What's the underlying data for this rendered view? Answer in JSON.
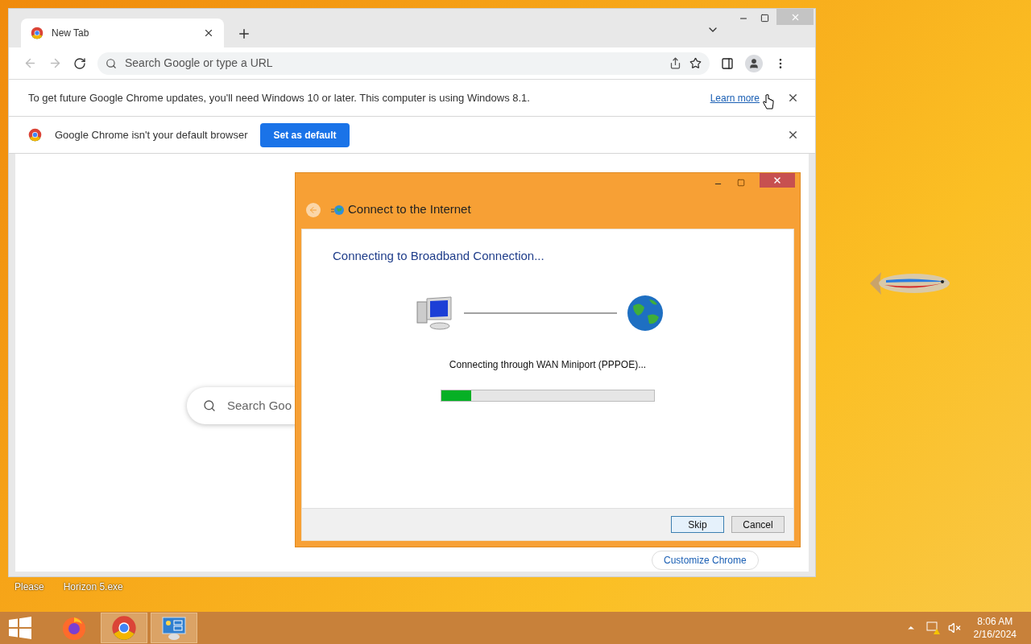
{
  "browser": {
    "tabs": [
      {
        "title": "New Tab",
        "selected": true
      }
    ],
    "address_bar": {
      "placeholder": "Search Google or type a URL"
    },
    "infobars": [
      {
        "kind": "notice",
        "text": "To get future Google Chrome updates, you'll need Windows 10 or later. This computer is using Windows 8.1.",
        "link": "Learn more"
      },
      {
        "kind": "default_browser",
        "text": "Google Chrome isn't your default browser",
        "button": "Set as default"
      }
    ],
    "page": {
      "search_placeholder": "Search Goo",
      "customize_button": "Customize Chrome"
    }
  },
  "dialog": {
    "title": "Connect to the Internet",
    "heading": "Connecting to Broadband Connection...",
    "status": "Connecting through WAN Miniport (PPPOE)...",
    "progress": {
      "level": 0.14
    },
    "buttons": [
      {
        "label": "Skip",
        "selected": true
      },
      {
        "label": "Cancel",
        "selected": false
      }
    ]
  },
  "desktop_icons": [
    {
      "label": "Please"
    },
    {
      "label": "Horizon 5.exe"
    }
  ],
  "taskbar": {
    "apps": [
      {
        "kind": "firefox",
        "active": false
      },
      {
        "kind": "chrome",
        "active": true
      },
      {
        "kind": "network",
        "active": true
      }
    ],
    "time": "8:06 AM",
    "date": "2/16/2024"
  }
}
